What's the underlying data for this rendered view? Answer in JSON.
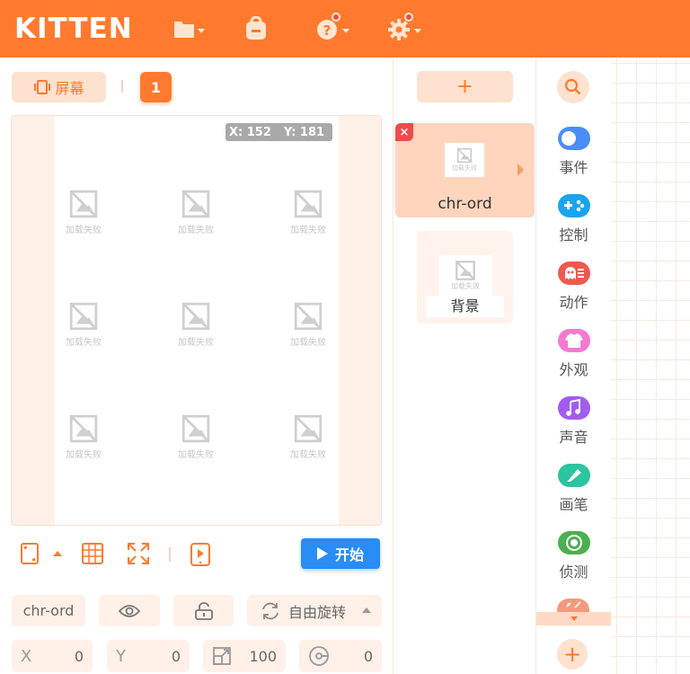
{
  "app": {
    "logo": "KITTEN"
  },
  "colors": {
    "primary": "#ff7a2e",
    "primary_light": "#ffe1cf",
    "start_button": "#2a8cf5",
    "delete": "#f04a4a"
  },
  "toolbar": {
    "icons": [
      "folder-icon",
      "backpack-icon",
      "help-icon",
      "settings-icon"
    ]
  },
  "stage_panel": {
    "screen_button_label": "屏幕",
    "current_screen": "1",
    "coords": {
      "x_label": "X: 152",
      "y_label": "Y: 181"
    },
    "failed_image_label": "加载失败",
    "start_button_label": "开始"
  },
  "sprite_props": {
    "name": "chr-ord",
    "rotation_mode": "自由旋转",
    "x_label": "X",
    "x_value": "0",
    "y_label": "Y",
    "y_value": "0",
    "scale_value": "100",
    "direction_value": "0"
  },
  "sprites": {
    "add_label": "+",
    "items": [
      {
        "name": "chr-ord",
        "thumb_label": "加载失败",
        "selected": true
      }
    ],
    "background": {
      "name": "背景",
      "thumb_label": "加载失败"
    }
  },
  "categories": [
    {
      "label": "事件",
      "color": "#4a8df8",
      "icon": "toggle-icon"
    },
    {
      "label": "控制",
      "color": "#1aa3f0",
      "icon": "gamepad-icon"
    },
    {
      "label": "动作",
      "color": "#f0584c",
      "icon": "ghost-icon"
    },
    {
      "label": "外观",
      "color": "#f57ad0",
      "icon": "shirt-icon"
    },
    {
      "label": "声音",
      "color": "#a15cf0",
      "icon": "music-icon"
    },
    {
      "label": "画笔",
      "color": "#2dc4a0",
      "icon": "brush-icon"
    },
    {
      "label": "侦测",
      "color": "#4caf50",
      "icon": "target-icon"
    }
  ],
  "add_category_label": "+"
}
